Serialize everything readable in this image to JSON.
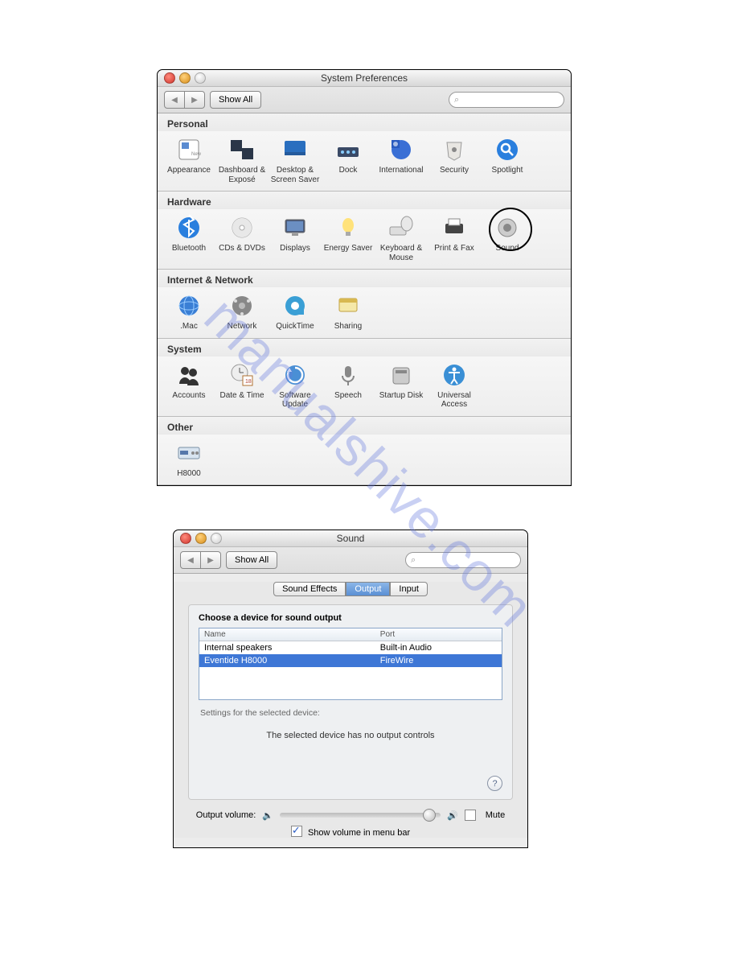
{
  "watermark": "manualshive.com",
  "win1": {
    "title": "System Preferences",
    "showAll": "Show All",
    "sections": [
      {
        "label": "Personal",
        "items": [
          {
            "name": "appearance",
            "label": "Appearance"
          },
          {
            "name": "dashboard",
            "label": "Dashboard & Exposé"
          },
          {
            "name": "desktop",
            "label": "Desktop & Screen Saver"
          },
          {
            "name": "dock",
            "label": "Dock"
          },
          {
            "name": "international",
            "label": "International"
          },
          {
            "name": "security",
            "label": "Security"
          },
          {
            "name": "spotlight",
            "label": "Spotlight"
          }
        ]
      },
      {
        "label": "Hardware",
        "items": [
          {
            "name": "bluetooth",
            "label": "Bluetooth"
          },
          {
            "name": "cds",
            "label": "CDs & DVDs"
          },
          {
            "name": "displays",
            "label": "Displays"
          },
          {
            "name": "energy",
            "label": "Energy Saver"
          },
          {
            "name": "keyboard",
            "label": "Keyboard & Mouse"
          },
          {
            "name": "print",
            "label": "Print & Fax"
          },
          {
            "name": "sound",
            "label": "Sound",
            "circled": true
          }
        ]
      },
      {
        "label": "Internet & Network",
        "items": [
          {
            "name": "dotmac",
            "label": ".Mac"
          },
          {
            "name": "network",
            "label": "Network"
          },
          {
            "name": "quicktime",
            "label": "QuickTime"
          },
          {
            "name": "sharing",
            "label": "Sharing"
          }
        ]
      },
      {
        "label": "System",
        "items": [
          {
            "name": "accounts",
            "label": "Accounts"
          },
          {
            "name": "datetime",
            "label": "Date & Time"
          },
          {
            "name": "swupdate",
            "label": "Software Update"
          },
          {
            "name": "speech",
            "label": "Speech"
          },
          {
            "name": "startup",
            "label": "Startup Disk"
          },
          {
            "name": "universal",
            "label": "Universal Access"
          }
        ]
      },
      {
        "label": "Other",
        "items": [
          {
            "name": "h8000",
            "label": "H8000"
          }
        ]
      }
    ]
  },
  "win2": {
    "title": "Sound",
    "showAll": "Show All",
    "tabs": [
      "Sound Effects",
      "Output",
      "Input"
    ],
    "selectedTab": "Output",
    "chooseLabel": "Choose a device for sound output",
    "cols": {
      "name": "Name",
      "port": "Port"
    },
    "devices": [
      {
        "name": "Internal speakers",
        "port": "Built-in Audio",
        "selected": false
      },
      {
        "name": "Eventide H8000",
        "port": "FireWire",
        "selected": true
      }
    ],
    "settingsFor": "Settings for the selected device:",
    "noControls": "The selected device has no output controls",
    "volumeLabel": "Output volume:",
    "muteLabel": "Mute",
    "menubarLabel": "Show volume in menu bar"
  }
}
